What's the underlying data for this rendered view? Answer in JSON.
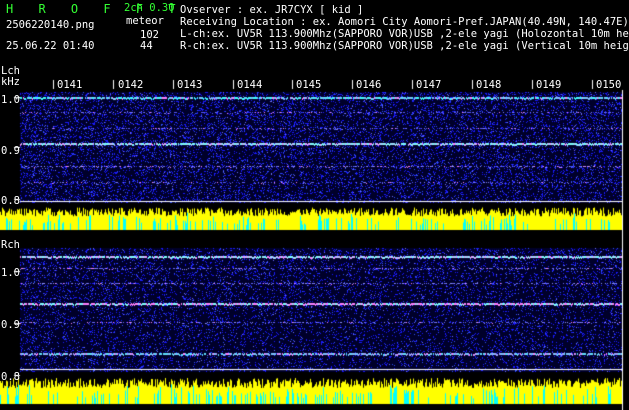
{
  "header": {
    "logo": "H R O F F T",
    "version": "2ch 0.30",
    "filename": "2506220140.png",
    "mode_label": "meteor",
    "datetime": "25.06.22 01:40",
    "count_lch": "102",
    "count_rch": "44",
    "observer": "Ovserver                 : ex. JR7CYX [ kid ]",
    "location": "Receiving Location : ex. Aomori City Aomori-Pref.JAPAN(40.49N, 140.47E)",
    "lch_desc": "L-ch:ex. UV5R 113.900Mhz(SAPPORO VOR)USB ,2-ele yagi (Holozontal 10m height)",
    "rch_desc": "R-ch:ex. UV5R 113.900Mhz(SAPPORO VOR)USB ,2-ele yagi (Vertical 10m height)"
  },
  "lch": {
    "label": "Lch",
    "unit": "kHz",
    "ticks": [
      "1.0",
      "0.9",
      "0.8"
    ]
  },
  "rch": {
    "label": "Rch",
    "ticks": [
      "1.0",
      "0.9",
      "0.8"
    ]
  },
  "time_axis": {
    "minutes": [
      "0141",
      "0142",
      "0143",
      "0144",
      "0145",
      "0146",
      "0147",
      "0148",
      "0149",
      "0150"
    ]
  },
  "colors": {
    "background": "#000000",
    "noise_blue": "#1a1aff",
    "carrier_cyan": "#80ffff",
    "level_yellow": "#ffff00",
    "level_cyan": "#00ffff",
    "text_green": "#33ff33"
  }
}
